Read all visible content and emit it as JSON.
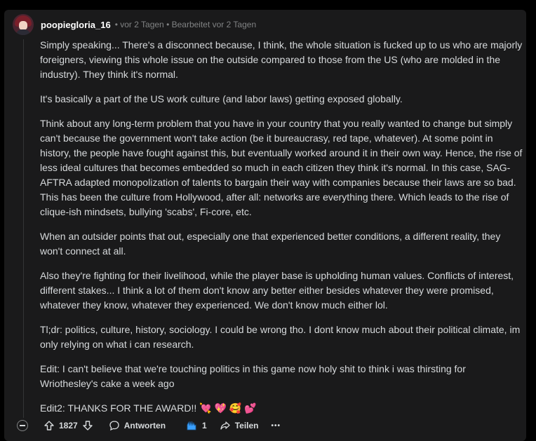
{
  "comment": {
    "username": "poopiegloria_16",
    "meta": "• vor 2 Tagen • Bearbeitet vor 2 Tagen",
    "paragraphs": [
      "Simply speaking... There's a disconnect because, I think, the whole situation is fucked up to us who are majorly foreigners, viewing this whole issue on the outside compared to those from the US (who are molded in the industry). They think it's normal.",
      "It's basically a part of the US work culture (and labor laws) getting exposed globally.",
      "Think about any long-term problem that you have in your country that you really wanted to change but simply can't because the government won't take action (be it bureaucrasy, red tape, whatever). At some point in history, the people have fought against this, but eventually worked around it in their own way. Hence, the rise of less ideal cultures that becomes embedded so much in each citizen they think it's normal. In this case, SAG-AFTRA adapted monopolization of talents to bargain their way with companies because their laws are so bad. This has been the culture from Hollywood, after all: networks are everything there. Which leads to the rise of clique-ish mindsets, bullying 'scabs', Fi-core, etc.",
      "When an outsider points that out, especially one that experienced better conditions, a different reality, they won't connect at all.",
      "Also they're fighting for their livelihood, while the player base is upholding human values. Conflicts of interest, different stakes... I think a lot of them don't know any better either besides whatever they were promised, whatever they know, whatever they experienced. We don't know much either lol.",
      "Tl;dr: politics, culture, history, sociology. I could be wrong tho. I dont know much about their political climate, im only relying on what i can research.",
      "Edit: I can't believe that we're touching politics in this game now holy shit to think i was thirsting for Wriothesley's cake a week ago",
      "Edit2: THANKS FOR THE AWARD!! 💘 💖 🥰 💕"
    ]
  },
  "actions": {
    "vote_count": "1827",
    "reply_label": "Antworten",
    "award_count": "1",
    "share_label": "Teilen",
    "more_label": "•••"
  },
  "icons": {
    "collapse": "collapse-icon",
    "upvote": "upvote-arrow-icon",
    "downvote": "downvote-arrow-icon",
    "reply": "speech-bubble-icon",
    "award": "award-hands-icon",
    "share": "share-arrow-icon",
    "more": "more-dots-icon"
  },
  "colors": {
    "background": "#000000",
    "card": "#1a1a1b",
    "text": "#d7dadc",
    "muted": "#818384",
    "award": "#3aa0ff"
  }
}
